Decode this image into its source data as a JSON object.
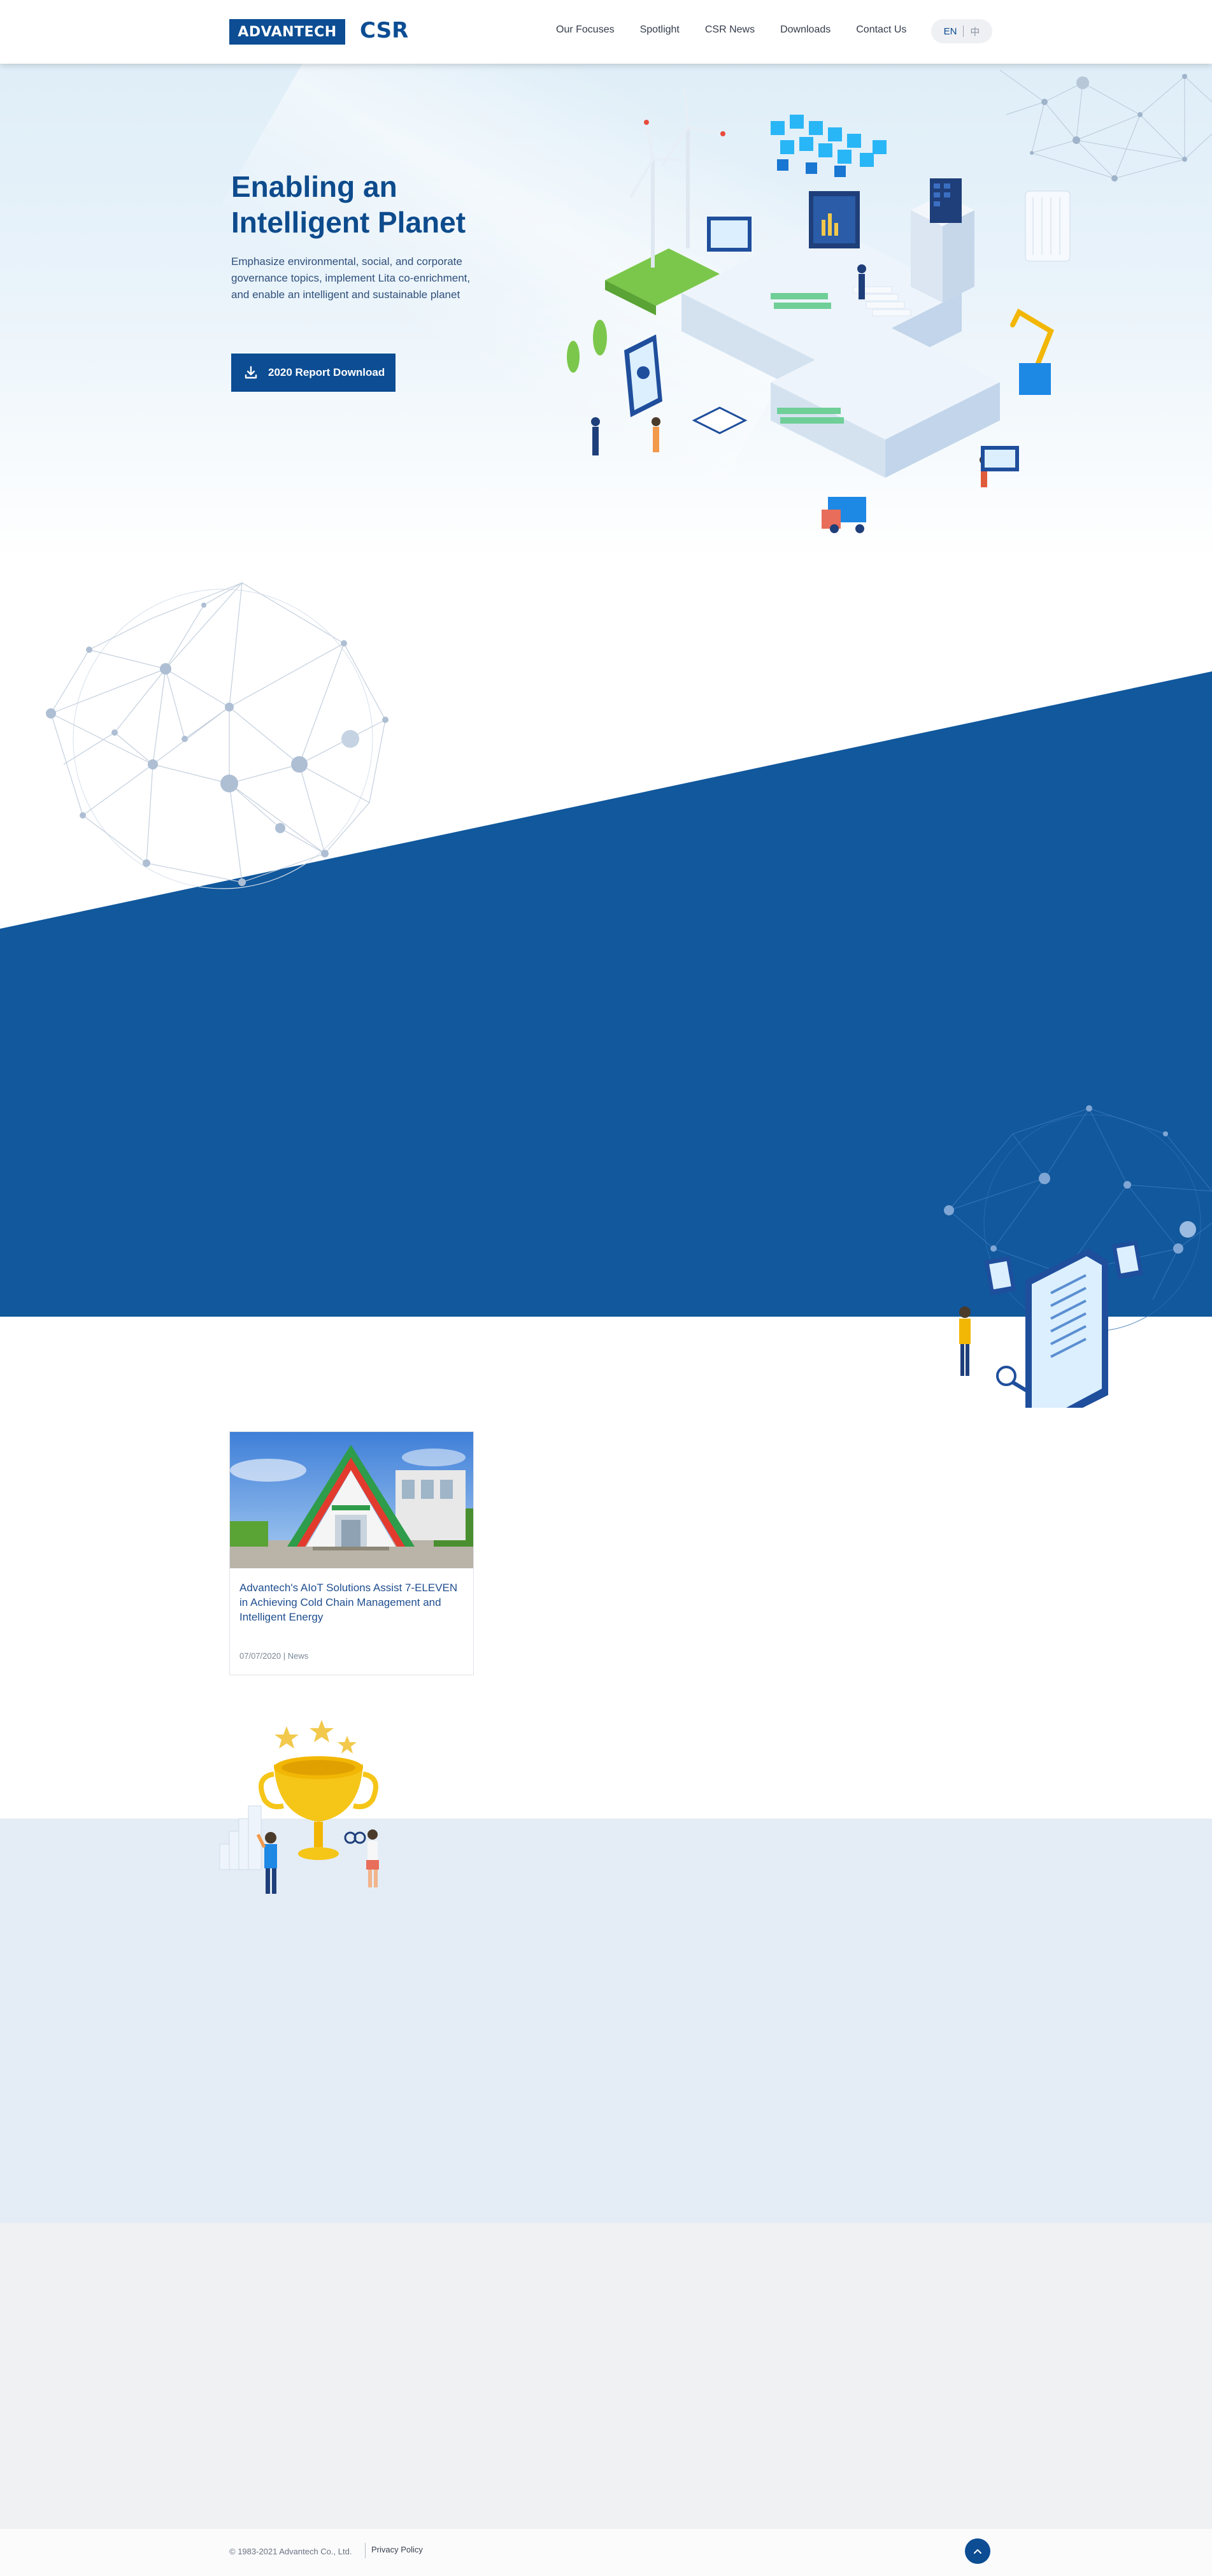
{
  "header": {
    "logo_text": "ADVANTECH",
    "title": "CSR",
    "nav": [
      "Our Focuses",
      "Spotlight",
      "CSR News",
      "Downloads",
      "Contact Us"
    ],
    "lang_en": "EN",
    "lang_zh": "中"
  },
  "hero": {
    "title_line1": "Enabling an",
    "title_line2": "Intelligent Planet",
    "description": "Emphasize environmental, social, and corporate governance topics, implement Lita co-enrichment, and enable an intelligent and sustainable planet",
    "button_label": "2020 Report Download"
  },
  "news": {
    "items": [
      {
        "title": "Advantech's AIoT Solutions Assist 7-ELEVEN in Achieving Cold Chain Management and Intelligent Energy",
        "date": "07/07/2020",
        "category": "News"
      }
    ]
  },
  "footer": {
    "copyright": "© 1983-2021 Advantech Co., Ltd.",
    "privacy": "Privacy Policy"
  },
  "colors": {
    "brand_blue": "#0c4d93",
    "section_blue": "#11589d",
    "light_blue_bg": "#e4edf5",
    "grey_bg": "#f0f1f2"
  },
  "icons": [
    "download-icon",
    "chevron-up-icon"
  ]
}
